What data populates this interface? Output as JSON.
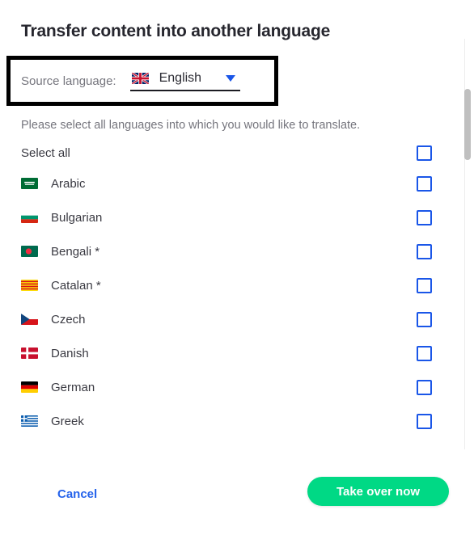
{
  "dialog": {
    "title": "Transfer content into another language",
    "instruction": "Please select all languages into which you would like to translate.",
    "select_all_label": "Select all"
  },
  "source": {
    "label": "Source language:",
    "value": "English",
    "flag": "gb-flag",
    "caret": "chevron-down-icon"
  },
  "languages": [
    {
      "label": "Arabic",
      "flag": "sa-flag",
      "checked": false
    },
    {
      "label": "Bulgarian",
      "flag": "bg-flag",
      "checked": false
    },
    {
      "label": "Bengali *",
      "flag": "bd-flag",
      "checked": false
    },
    {
      "label": "Catalan *",
      "flag": "ct-flag",
      "checked": false
    },
    {
      "label": "Czech",
      "flag": "cz-flag",
      "checked": false
    },
    {
      "label": "Danish",
      "flag": "dk-flag",
      "checked": false
    },
    {
      "label": "German",
      "flag": "de-flag",
      "checked": false
    },
    {
      "label": "Greek",
      "flag": "gr-flag",
      "checked": false
    }
  ],
  "footer": {
    "cancel_label": "Cancel",
    "primary_label": "Take over now"
  },
  "colors": {
    "primary_button": "#00d985",
    "link": "#2563eb",
    "checkbox_border": "#1a56e8",
    "highlight_box": "#000000"
  }
}
